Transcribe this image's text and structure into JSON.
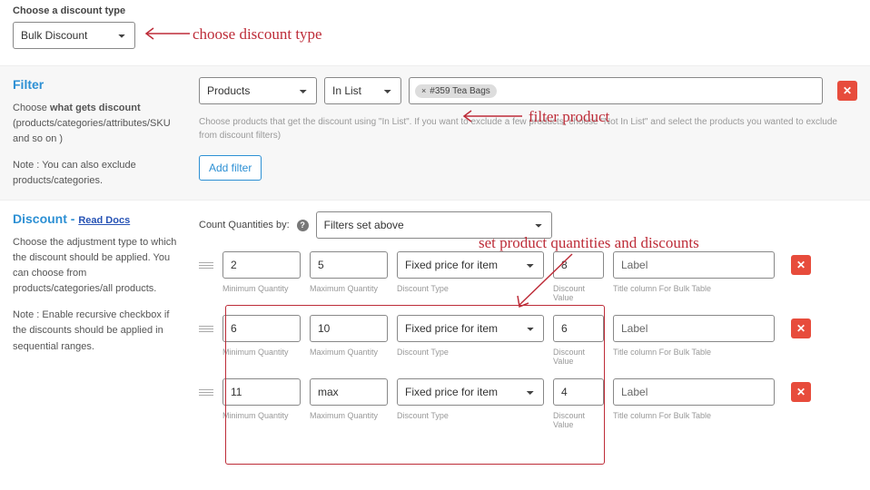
{
  "discount_type": {
    "label": "Choose a discount type",
    "selected": "Bulk Discount"
  },
  "filter_section": {
    "title": "Filter",
    "desc_prefix": "Choose ",
    "desc_bold": "what gets discount",
    "desc_suffix": " (products/categories/attributes/SKU and so on )",
    "note": "Note : You can also exclude products/categories.",
    "filter_entity": "Products",
    "filter_op": "In List",
    "tag_text": "#359 Tea Bags",
    "help_text": "Choose products that get the discount using \"In List\". If you want to exclude a few products, choose \"Not In List\" and select the products you wanted to exclude from discount filters)",
    "add_filter": "Add filter"
  },
  "discount_section": {
    "title": "Discount - ",
    "docs_link": "Read Docs",
    "desc": "Choose the adjustment type to which the discount should be applied. You can choose from products/categories/all products.",
    "note": "Note : Enable recursive checkbox if the discounts should be applied in sequential ranges.",
    "count_label": "Count Quantities by:",
    "count_selected": "Filters set above",
    "labels": {
      "min_qty": "Minimum Quantity",
      "max_qty": "Maximum Quantity",
      "dtype": "Discount Type",
      "dval": "Discount Value",
      "title_col": "Title column For Bulk Table"
    },
    "rows": [
      {
        "min": "2",
        "max": "5",
        "type": "Fixed price for item",
        "value": "8",
        "label_ph": "Label"
      },
      {
        "min": "6",
        "max": "10",
        "type": "Fixed price for item",
        "value": "6",
        "label_ph": "Label"
      },
      {
        "min": "11",
        "max": "max",
        "type": "Fixed price for item",
        "value": "4",
        "label_ph": "Label"
      }
    ]
  },
  "annotations": {
    "a1": "choose discount type",
    "a2": "filter product",
    "a3": "set product quantities and discounts"
  }
}
